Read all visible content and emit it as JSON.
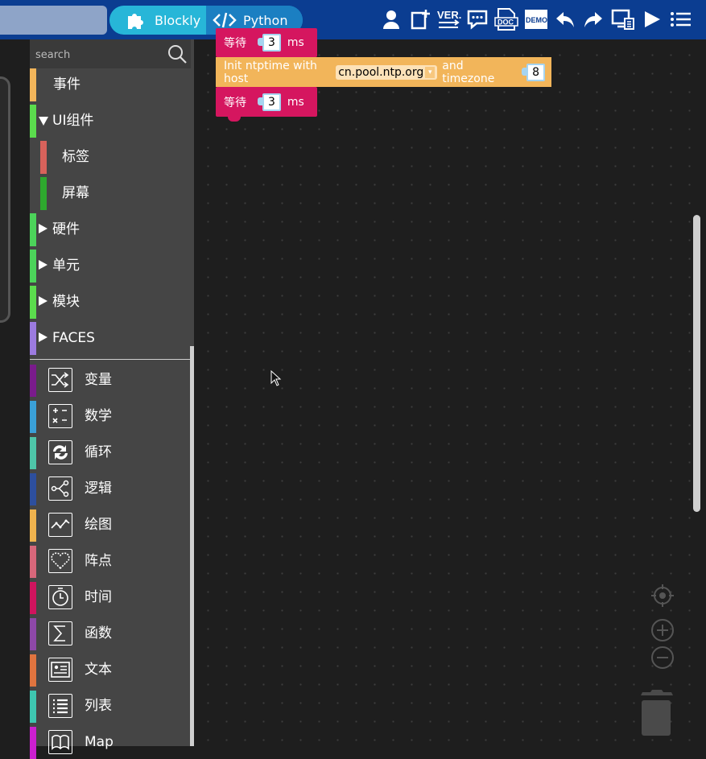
{
  "topbar": {
    "mode_blockly_label": "Blockly",
    "mode_python_label": "Python",
    "icons": [
      "user-icon",
      "add-page-icon",
      "version-icon",
      "chat-icon",
      "doc-icon",
      "demo-icon",
      "undo-icon",
      "redo-icon",
      "device-icon",
      "run-icon",
      "menu-icon"
    ],
    "version_icon_text": "VER.",
    "doc_icon_text": "DOC",
    "demo_icon_text": "DEMO",
    "bg_color": "#0b3d91"
  },
  "toolbox": {
    "search_placeholder": "search",
    "categories": [
      {
        "label": "事件",
        "color": "#f2b55a",
        "expand": "none"
      },
      {
        "label": "UI组件",
        "color": "#5bdc4d",
        "expand": "open"
      },
      {
        "label": "标签",
        "color": "#d8625b",
        "expand": "child"
      },
      {
        "label": "屏幕",
        "color": "#2ea82e",
        "expand": "child"
      },
      {
        "label": "硬件",
        "color": "#4cd45a",
        "expand": "closed"
      },
      {
        "label": "单元",
        "color": "#4cd45a",
        "expand": "closed"
      },
      {
        "label": "模块",
        "color": "#5bdc4d",
        "expand": "closed"
      },
      {
        "label": "FACES",
        "color": "#9c7be0",
        "expand": "closed"
      }
    ],
    "builtins": [
      {
        "label": "变量",
        "color": "#7a1b8c",
        "icon": "shuffle-icon"
      },
      {
        "label": "数学",
        "color": "#3aa0d8",
        "icon": "math-icon"
      },
      {
        "label": "循环",
        "color": "#4ec5a8",
        "icon": "loop-icon"
      },
      {
        "label": "逻辑",
        "color": "#2d4f9e",
        "icon": "logic-icon"
      },
      {
        "label": "绘图",
        "color": "#f0b34e",
        "icon": "graph-icon"
      },
      {
        "label": "阵点",
        "color": "#d8677a",
        "icon": "heart-icon"
      },
      {
        "label": "时间",
        "color": "#d0145e",
        "icon": "clock-icon"
      },
      {
        "label": "函数",
        "color": "#8e48a8",
        "icon": "sigma-icon"
      },
      {
        "label": "文本",
        "color": "#e0743f",
        "icon": "text-card-icon"
      },
      {
        "label": "列表",
        "color": "#3ec6b0",
        "icon": "list-icon"
      },
      {
        "label": "Map",
        "color": "#cc1fd0",
        "icon": "map-icon"
      }
    ]
  },
  "workspace": {
    "blocks": [
      {
        "type": "wait",
        "label": "等待",
        "value": "3",
        "unit": "ms"
      },
      {
        "type": "ntptime",
        "label": "Init ntptime with host",
        "host": "cn.pool.ntp.org",
        "dropdown_glyph": "▾",
        "mid_label": "and timezone",
        "timezone": "8"
      },
      {
        "type": "wait",
        "label": "等待",
        "value": "3",
        "unit": "ms"
      }
    ]
  }
}
